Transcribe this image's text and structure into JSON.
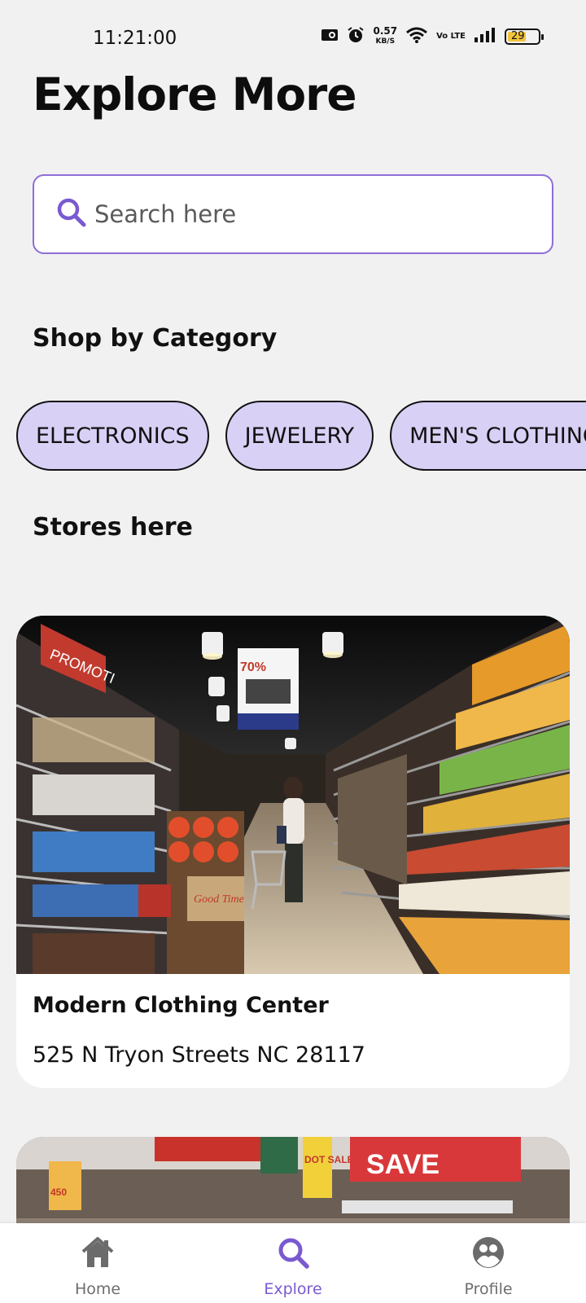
{
  "status_bar": {
    "time": "11:21:00",
    "speed_value": "0.57",
    "speed_unit": "KB/S",
    "network": "Vo LTE",
    "battery": "29"
  },
  "header": {
    "title": "Explore More"
  },
  "search": {
    "placeholder": "Search here"
  },
  "categories": {
    "title": "Shop by Category",
    "items": [
      "ELECTRONICS",
      "JEWELERY",
      "MEN'S CLOTHING"
    ]
  },
  "stores": {
    "title": "Stores here",
    "items": [
      {
        "name": "Modern Clothing Center",
        "address": "525 N Tryon Streets NC 28117"
      }
    ]
  },
  "store_photo_signs": {
    "promo": "PROMOTI",
    "discount": "70%",
    "product_brand": "Good Time",
    "sale_badge": "450",
    "save": "SAVE",
    "dot_sale": "DOT SALE"
  },
  "nav": {
    "items": [
      {
        "label": "Home",
        "icon": "home-icon"
      },
      {
        "label": "Explore",
        "icon": "search-icon",
        "active": true
      },
      {
        "label": "Profile",
        "icon": "profile-icon"
      }
    ]
  },
  "colors": {
    "accent": "#7a5ad0",
    "chip_bg": "#d9d0f6",
    "background": "#f1f1f1"
  }
}
